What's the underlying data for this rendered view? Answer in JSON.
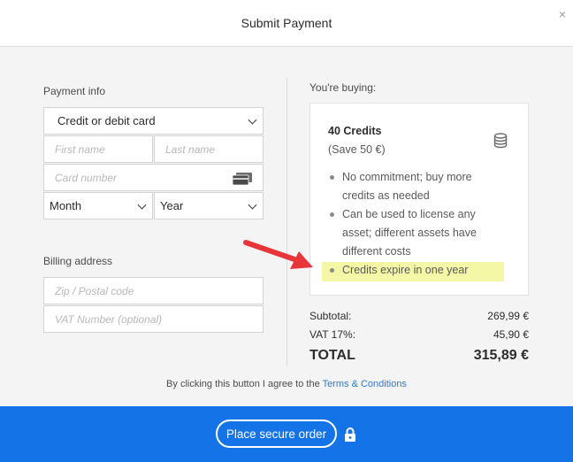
{
  "header": {
    "title": "Submit Payment",
    "close_symbol": "×"
  },
  "payment": {
    "section_label": "Payment info",
    "method_selected": "Credit or debit card",
    "first_name_placeholder": "First name",
    "last_name_placeholder": "Last name",
    "card_number_placeholder": "Card number",
    "month_selected": "Month",
    "year_selected": "Year"
  },
  "billing": {
    "section_label": "Billing address",
    "zip_placeholder": "Zip / Postal code",
    "vat_placeholder": "VAT Number (optional)"
  },
  "buying": {
    "label": "You're buying:",
    "product_title": "40 Credits",
    "savings": "(Save 50 €)",
    "bullets": [
      {
        "lines": [
          "No commitment; buy more",
          "credits as needed"
        ]
      },
      {
        "lines": [
          "Can be used to license any",
          "asset; different assets have",
          "different costs"
        ]
      },
      {
        "lines": [
          "Credits expire in one year"
        ],
        "highlight_color": "#f4f7a5"
      }
    ]
  },
  "summary": {
    "subtotal_label": "Subtotal:",
    "subtotal_value": "269,99 €",
    "vat_label": "VAT 17%:",
    "vat_value": "45,90 €",
    "total_label": "TOTAL",
    "total_value": "315,89 €"
  },
  "terms": {
    "prefix": "By clicking this button I agree to the ",
    "link": "Terms & Conditions"
  },
  "footer": {
    "order_label": "Place secure order",
    "bar_color": "#1473e6"
  },
  "annotation": {
    "arrow_color": "#e8353a"
  }
}
